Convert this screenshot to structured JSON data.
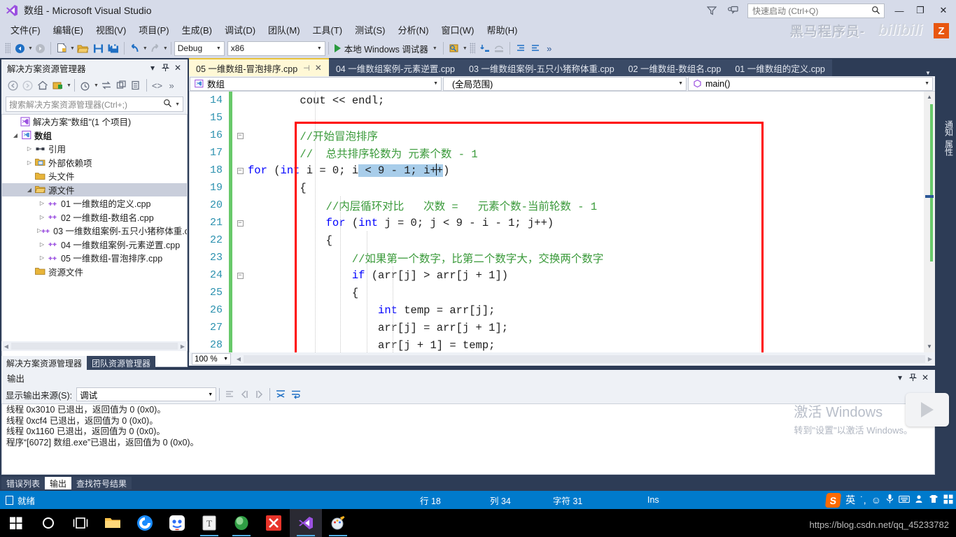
{
  "window": {
    "title": "数组 - Microsoft Visual Studio",
    "quick_launch_placeholder": "快速启动 (Ctrl+Q)",
    "minimize": "—",
    "restore": "❐",
    "close": "✕",
    "brand_watermark": "黑马程序员-",
    "bili_watermark": "bilibili",
    "z_badge": "Z"
  },
  "menubar": {
    "items": [
      "文件(F)",
      "编辑(E)",
      "视图(V)",
      "项目(P)",
      "生成(B)",
      "调试(D)",
      "团队(M)",
      "工具(T)",
      "测试(S)",
      "分析(N)",
      "窗口(W)",
      "帮助(H)"
    ]
  },
  "toolbar": {
    "config": "Debug",
    "platform": "x86",
    "run_label": "本地 Windows 调试器"
  },
  "solution_explorer": {
    "title": "解决方案资源管理器",
    "search_placeholder": "搜索解决方案资源管理器(Ctrl+;)",
    "tree": [
      {
        "label": "解决方案\"数组\"(1 个项目)",
        "depth": 0,
        "expander": "",
        "icon": "solution-icon",
        "selected": false
      },
      {
        "label": "数组",
        "depth": 1,
        "expander": "▴",
        "icon": "project-icon",
        "selected": false
      },
      {
        "label": "引用",
        "depth": 2,
        "expander": "▸",
        "icon": "references-icon",
        "selected": false
      },
      {
        "label": "外部依赖项",
        "depth": 2,
        "expander": "▸",
        "icon": "folder-dep-icon",
        "selected": false
      },
      {
        "label": "头文件",
        "depth": 2,
        "expander": "",
        "icon": "folder-icon",
        "selected": false
      },
      {
        "label": "源文件",
        "depth": 2,
        "expander": "▴",
        "icon": "folder-open-icon",
        "selected": true
      },
      {
        "label": "01 一维数组的定义.cpp",
        "depth": 3,
        "expander": "▸",
        "icon": "cpp-icon",
        "selected": false
      },
      {
        "label": "02 一维数组-数组名.cpp",
        "depth": 3,
        "expander": "▸",
        "icon": "cpp-icon",
        "selected": false
      },
      {
        "label": "03 一维数组案例-五只小猪称体重.cpp",
        "depth": 3,
        "expander": "▸",
        "icon": "cpp-icon",
        "selected": false
      },
      {
        "label": "04 一维数组案例-元素逆置.cpp",
        "depth": 3,
        "expander": "▸",
        "icon": "cpp-icon",
        "selected": false
      },
      {
        "label": "05 一维数组-冒泡排序.cpp",
        "depth": 3,
        "expander": "▸",
        "icon": "cpp-icon",
        "selected": false
      },
      {
        "label": "资源文件",
        "depth": 2,
        "expander": "",
        "icon": "folder-icon",
        "selected": false
      }
    ],
    "dock_tabs": [
      {
        "label": "解决方案资源管理器",
        "active": true
      },
      {
        "label": "团队资源管理器",
        "active": false
      }
    ]
  },
  "editor": {
    "tabs": [
      {
        "label": "05 一维数组-冒泡排序.cpp",
        "active": true
      },
      {
        "label": "04 一维数组案例-元素逆置.cpp",
        "active": false
      },
      {
        "label": "03 一维数组案例-五只小猪称体重.cpp",
        "active": false
      },
      {
        "label": "02 一维数组-数组名.cpp",
        "active": false
      },
      {
        "label": "01 一维数组的定义.cpp",
        "active": false
      }
    ],
    "nav_project": "数组",
    "nav_scope": "(全局范围)",
    "nav_member": "main()",
    "zoom": "100 %",
    "lines": [
      {
        "num": "14",
        "fold": "",
        "changed": true,
        "text": "        cout << endl;"
      },
      {
        "num": "15",
        "fold": "",
        "changed": true,
        "text": ""
      },
      {
        "num": "16",
        "fold": "box",
        "changed": true,
        "text": "        //开始冒泡排序"
      },
      {
        "num": "17",
        "fold": "",
        "changed": true,
        "text": "        //  总共排序轮数为 元素个数 - 1"
      },
      {
        "num": "18",
        "fold": "box",
        "changed": true,
        "text": "        for (int i = 0; i < 9 - 1; i++)"
      },
      {
        "num": "19",
        "fold": "",
        "changed": true,
        "text": "        {"
      },
      {
        "num": "20",
        "fold": "",
        "changed": true,
        "text": "            //内层循环对比   次数 =   元素个数-当前轮数 - 1"
      },
      {
        "num": "21",
        "fold": "box",
        "changed": true,
        "text": "            for (int j = 0; j < 9 - i - 1; j++)"
      },
      {
        "num": "22",
        "fold": "",
        "changed": true,
        "text": "            {"
      },
      {
        "num": "23",
        "fold": "",
        "changed": true,
        "text": "                //如果第一个数字，比第二个数字大，交换两个数字"
      },
      {
        "num": "24",
        "fold": "box",
        "changed": true,
        "text": "                if (arr[j] > arr[j + 1])"
      },
      {
        "num": "25",
        "fold": "",
        "changed": true,
        "text": "                {"
      },
      {
        "num": "26",
        "fold": "",
        "changed": true,
        "text": "                    int temp = arr[j];"
      },
      {
        "num": "27",
        "fold": "",
        "changed": true,
        "text": "                    arr[j] = arr[j + 1];"
      },
      {
        "num": "28",
        "fold": "",
        "changed": true,
        "text": "                    arr[j + 1] = temp;"
      }
    ],
    "selected_fragment": "< 9 - 1; i++"
  },
  "output_panel": {
    "title": "输出",
    "source_label": "显示输出来源(S):",
    "source_value": "调试",
    "lines": [
      "线程 0x3010 已退出，返回值为 0 (0x0)。",
      "线程 0xcf4 已退出，返回值为 0 (0x0)。",
      "线程 0x1160 已退出，返回值为 0 (0x0)。",
      "程序“[6072] 数组.exe”已退出，返回值为 0 (0x0)。"
    ],
    "tabs": [
      {
        "label": "错误列表",
        "active": false
      },
      {
        "label": "输出",
        "active": true
      },
      {
        "label": "查找符号结果",
        "active": false
      }
    ]
  },
  "right_dock": {
    "items": [
      "通知",
      "属性"
    ]
  },
  "statusbar": {
    "ready": "就绪",
    "line": "行 18",
    "column": "列 34",
    "character": "字符 31",
    "insert_mode": "Ins",
    "ime_mode": "英"
  },
  "activate_windows": {
    "line1": "激活 Windows",
    "line2": "转到\"设置\"以激活 Windows。"
  },
  "taskbar": {
    "url_text": "https://blog.csdn.net/qq_45233782"
  },
  "colors": {
    "accent_blue": "#007acc",
    "titlebar": "#d6dbe9",
    "dock_bg": "#2d3c56",
    "active_tab": "#fff8d6",
    "highlight_red": "#ff0000",
    "comment_green": "#3a9a3a",
    "keyword_blue": "#0000ff",
    "selection_blue": "#a8cdea",
    "change_green": "#68c96a",
    "linenum": "#2b91af"
  }
}
